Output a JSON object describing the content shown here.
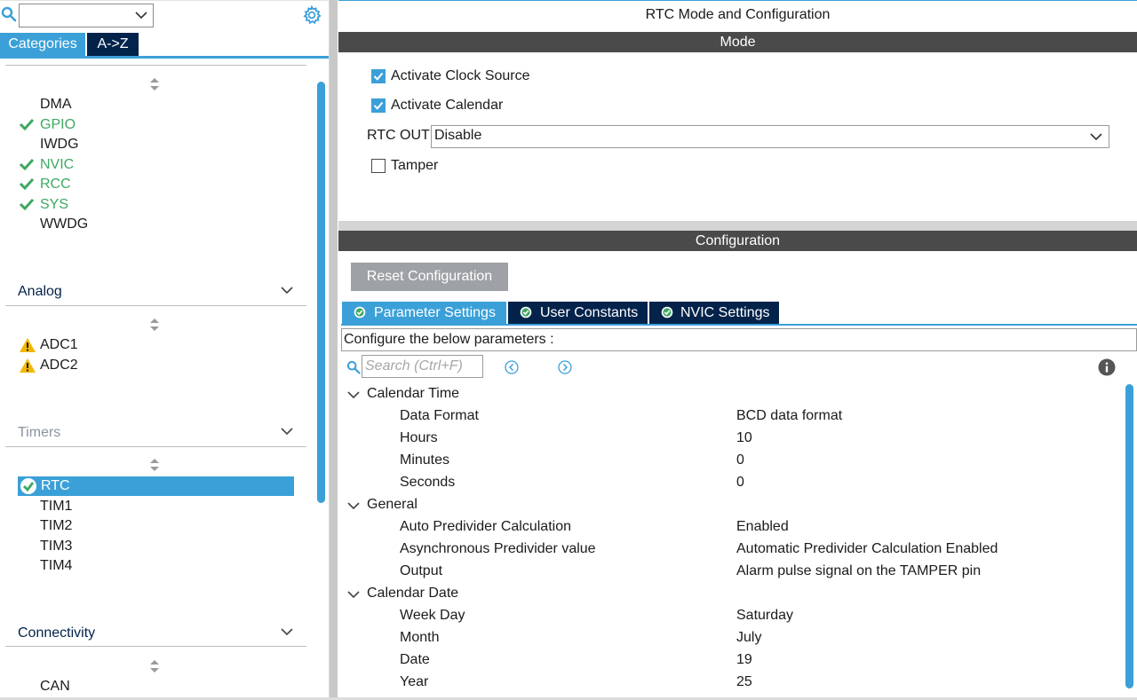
{
  "colors": {
    "accent": "#3ba0d8",
    "navy": "#03234b",
    "band": "#4a4a4a",
    "ok_green": "#3fa862",
    "warn_yellow": "#f2b705"
  },
  "sidebar": {
    "tabs": [
      {
        "label": "Categories",
        "active": true
      },
      {
        "label": "A->Z",
        "active": false
      }
    ],
    "system_core_items": [
      {
        "label": "DMA",
        "status": "none"
      },
      {
        "label": "GPIO",
        "status": "ok"
      },
      {
        "label": "IWDG",
        "status": "none"
      },
      {
        "label": "NVIC",
        "status": "ok"
      },
      {
        "label": "RCC",
        "status": "ok"
      },
      {
        "label": "SYS",
        "status": "ok"
      },
      {
        "label": "WWDG",
        "status": "none"
      }
    ],
    "analog": {
      "title": "Analog",
      "items": [
        {
          "label": "ADC1",
          "status": "warning"
        },
        {
          "label": "ADC2",
          "status": "warning"
        }
      ]
    },
    "timers": {
      "title": "Timers",
      "items": [
        {
          "label": "RTC",
          "status": "selected"
        },
        {
          "label": "TIM1",
          "status": "none"
        },
        {
          "label": "TIM2",
          "status": "none"
        },
        {
          "label": "TIM3",
          "status": "none"
        },
        {
          "label": "TIM4",
          "status": "none"
        }
      ]
    },
    "connectivity": {
      "title": "Connectivity",
      "items": [
        {
          "label": "CAN",
          "status": "none"
        }
      ]
    }
  },
  "main": {
    "title": "RTC Mode and Configuration",
    "mode": {
      "header": "Mode",
      "activate_clock_source": {
        "label": "Activate Clock Source",
        "checked": true
      },
      "activate_calendar": {
        "label": "Activate Calendar",
        "checked": true
      },
      "rtc_out": {
        "label": "RTC OUT",
        "value": "Disable"
      },
      "tamper": {
        "label": "Tamper",
        "checked": false
      }
    },
    "configuration": {
      "header": "Configuration",
      "reset_label": "Reset Configuration",
      "tabs": [
        {
          "label": "Parameter Settings",
          "active": true
        },
        {
          "label": "User Constants",
          "active": false
        },
        {
          "label": "NVIC Settings",
          "active": false
        }
      ],
      "hint": "Configure the below parameters :",
      "search_placeholder": "Search (Ctrl+F)",
      "groups": [
        {
          "name": "Calendar Time",
          "params": [
            {
              "name": "Data Format",
              "value": "BCD data format"
            },
            {
              "name": "Hours",
              "value": "10"
            },
            {
              "name": "Minutes",
              "value": "0"
            },
            {
              "name": "Seconds",
              "value": "0"
            }
          ]
        },
        {
          "name": "General",
          "params": [
            {
              "name": "Auto Predivider Calculation",
              "value": "Enabled"
            },
            {
              "name": "Asynchronous Predivider value",
              "value": "Automatic Predivider Calculation Enabled"
            },
            {
              "name": "Output",
              "value": "Alarm pulse signal on the TAMPER pin"
            }
          ]
        },
        {
          "name": "Calendar Date",
          "params": [
            {
              "name": "Week Day",
              "value": "Saturday"
            },
            {
              "name": "Month",
              "value": "July"
            },
            {
              "name": "Date",
              "value": "19"
            },
            {
              "name": "Year",
              "value": "25"
            }
          ]
        }
      ]
    }
  }
}
